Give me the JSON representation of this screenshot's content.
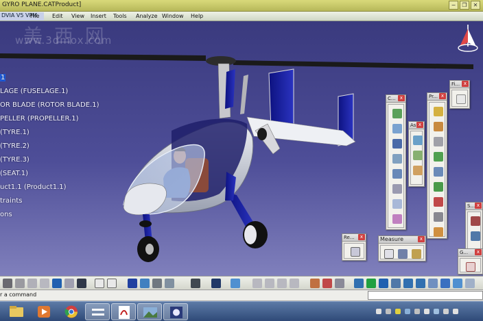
{
  "window": {
    "title": "GYRO PLANE.CATProduct]",
    "app_title": "DVIA V5 VPM",
    "buttons": [
      "−",
      "❐",
      "✕"
    ]
  },
  "menu": {
    "items": [
      "File",
      "Edit",
      "View",
      "Insert",
      "Tools",
      "Analyze",
      "Window",
      "Help"
    ]
  },
  "watermark": {
    "text": "美 西 网",
    "url": "www.3dmox.com"
  },
  "tree": {
    "root": "1",
    "items": [
      "LAGE (FUSELAGE.1)",
      "OR BLADE (ROTOR BLADE.1)",
      "PELLER (PROPELLER.1)",
      "(TYRE.1)",
      "(TYRE.2)",
      "(TYRE.3)",
      "(SEAT.1)",
      "uct1.1 (Product1.1)",
      "traints",
      "ons"
    ]
  },
  "toolbars": {
    "c": "C...",
    "as": "As...",
    "pr": "Pr...",
    "fi": "Fi...",
    "s": "S...",
    "re": "Re...",
    "measure": "Measure",
    "g": "G..."
  },
  "status": {
    "prompt": "r a command",
    "command_value": ""
  },
  "colors": {
    "viewport_top": "#3a3a7e",
    "viewport_bottom": "#8080bc",
    "selection": "#1f5bd8",
    "airframe_blue": "#1a1f9a"
  },
  "taskbar": {
    "icons": [
      "file-explorer-icon",
      "media-player-icon",
      "chrome-icon",
      "switch-icon",
      "pdf-icon",
      "photo-viewer-icon",
      "catia-icon"
    ]
  }
}
